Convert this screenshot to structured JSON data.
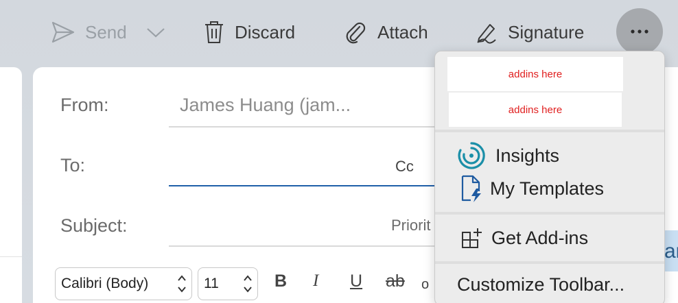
{
  "toolbar": {
    "send_label": "Send",
    "discard_label": "Discard",
    "attach_label": "Attach",
    "signature_label": "Signature"
  },
  "compose": {
    "from_label": "From:",
    "from_value": "James Huang (jam...",
    "to_label": "To:",
    "to_value": "",
    "cc_label": "Cc",
    "subject_label": "Subject:",
    "priority_label": "Priorit",
    "font_family": "Calibri (Body)",
    "font_size": "11",
    "bold_label": "B",
    "italic_label": "I",
    "underline_label": "U",
    "strikethrough_label": "ab",
    "partial_right_text": "ar"
  },
  "overflow_menu": {
    "addin_slots": [
      "addins here",
      "addins here"
    ],
    "items": [
      {
        "label": "Insights",
        "icon": "insights-icon"
      },
      {
        "label": "My Templates",
        "icon": "templates-icon"
      },
      {
        "label": "Get Add-ins",
        "icon": "add-ins-icon"
      },
      {
        "label": "Customize Toolbar...",
        "icon": ""
      }
    ]
  },
  "colors": {
    "accent": "#1f5fa8",
    "addin_text": "#e01e1e",
    "insights": "#1b8fa8"
  }
}
